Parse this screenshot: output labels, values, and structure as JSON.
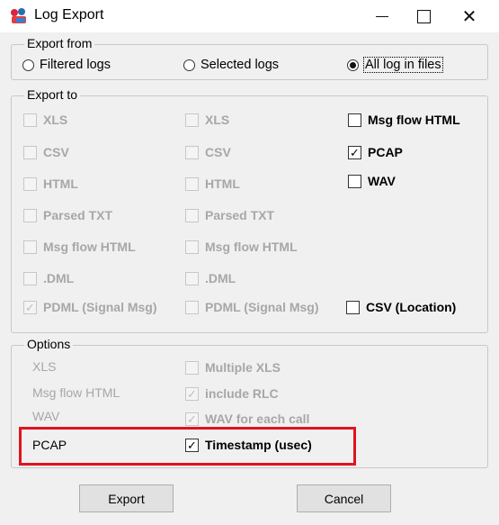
{
  "window": {
    "title": "Log Export",
    "icon": "log-export-app-icon"
  },
  "export_from": {
    "label": "Export from",
    "options": [
      {
        "label": "Filtered logs",
        "selected": false
      },
      {
        "label": "Selected logs",
        "selected": false
      },
      {
        "label": "All log in files",
        "selected": true
      }
    ]
  },
  "export_to": {
    "label": "Export to",
    "col1": [
      {
        "label": "XLS",
        "checked": false,
        "enabled": false
      },
      {
        "label": "CSV",
        "checked": false,
        "enabled": false
      },
      {
        "label": "HTML",
        "checked": false,
        "enabled": false
      },
      {
        "label": "Parsed TXT",
        "checked": false,
        "enabled": false
      },
      {
        "label": "Msg flow HTML",
        "checked": false,
        "enabled": false
      },
      {
        "label": ".DML",
        "checked": false,
        "enabled": false
      },
      {
        "label": "PDML (Signal Msg)",
        "checked": true,
        "enabled": false
      }
    ],
    "col2": [
      {
        "label": "XLS",
        "checked": false,
        "enabled": false
      },
      {
        "label": "CSV",
        "checked": false,
        "enabled": false
      },
      {
        "label": "HTML",
        "checked": false,
        "enabled": false
      },
      {
        "label": "Parsed TXT",
        "checked": false,
        "enabled": false
      },
      {
        "label": "Msg flow HTML",
        "checked": false,
        "enabled": false
      },
      {
        "label": ".DML",
        "checked": false,
        "enabled": false
      },
      {
        "label": "PDML (Signal Msg)",
        "checked": false,
        "enabled": false
      }
    ],
    "col3": [
      {
        "label": "Msg flow HTML",
        "checked": false,
        "enabled": true
      },
      {
        "label": "PCAP",
        "checked": true,
        "enabled": true
      },
      {
        "label": "WAV",
        "checked": false,
        "enabled": true
      }
    ],
    "csv_location": {
      "label": "CSV (Location)",
      "checked": false,
      "enabled": true
    }
  },
  "options": {
    "label": "Options",
    "rows": [
      {
        "name": "XLS",
        "enabled": false,
        "option": {
          "label": "Multiple XLS",
          "checked": false,
          "enabled": false
        }
      },
      {
        "name": "Msg flow HTML",
        "enabled": false,
        "option": {
          "label": "include RLC",
          "checked": true,
          "enabled": false
        }
      },
      {
        "name": "WAV",
        "enabled": false,
        "option": {
          "label": "WAV for each call",
          "checked": true,
          "enabled": false
        }
      },
      {
        "name": "PCAP",
        "enabled": true,
        "option": {
          "label": "Timestamp (usec)",
          "checked": true,
          "enabled": true
        }
      }
    ]
  },
  "buttons": {
    "export": "Export",
    "cancel": "Cancel"
  },
  "colors": {
    "highlight": "#e0141e",
    "disabled_text": "#a7a7a7",
    "dialog_bg": "#f0f0f0"
  }
}
